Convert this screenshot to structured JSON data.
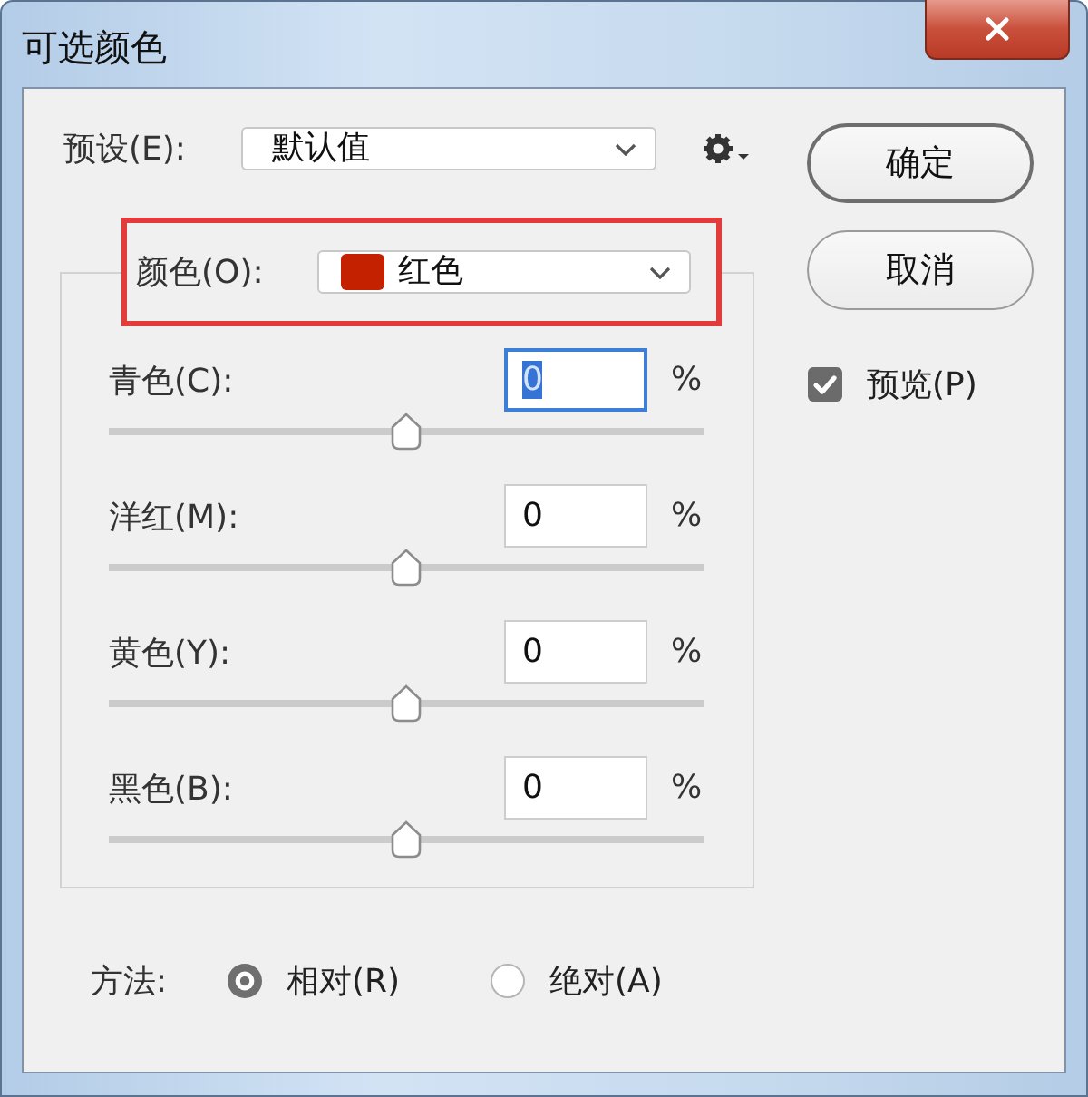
{
  "window": {
    "title": "可选颜色"
  },
  "preset": {
    "label": "预设(E):",
    "value": "默认值"
  },
  "color_selector": {
    "label": "颜色(O):",
    "value": "红色",
    "color": "#c42100",
    "highlighted": true
  },
  "channels": [
    {
      "label": "青色(C):",
      "value": "0",
      "unit": "%",
      "level": 0.5,
      "focused": true
    },
    {
      "label": "洋红(M):",
      "value": "0",
      "unit": "%",
      "level": 0.5,
      "focused": false
    },
    {
      "label": "黄色(Y):",
      "value": "0",
      "unit": "%",
      "level": 0.5,
      "focused": false
    },
    {
      "label": "黑色(B):",
      "value": "0",
      "unit": "%",
      "level": 0.5,
      "focused": false
    }
  ],
  "buttons": [
    {
      "label": "确定",
      "default": true
    },
    {
      "label": "取消",
      "default": false
    }
  ],
  "preview": {
    "label": "预览(P)",
    "checked": true
  },
  "method": {
    "label": "方法:",
    "options": [
      {
        "label": "相对(R)",
        "selected": true
      },
      {
        "label": "绝对(A)",
        "selected": false
      }
    ]
  }
}
